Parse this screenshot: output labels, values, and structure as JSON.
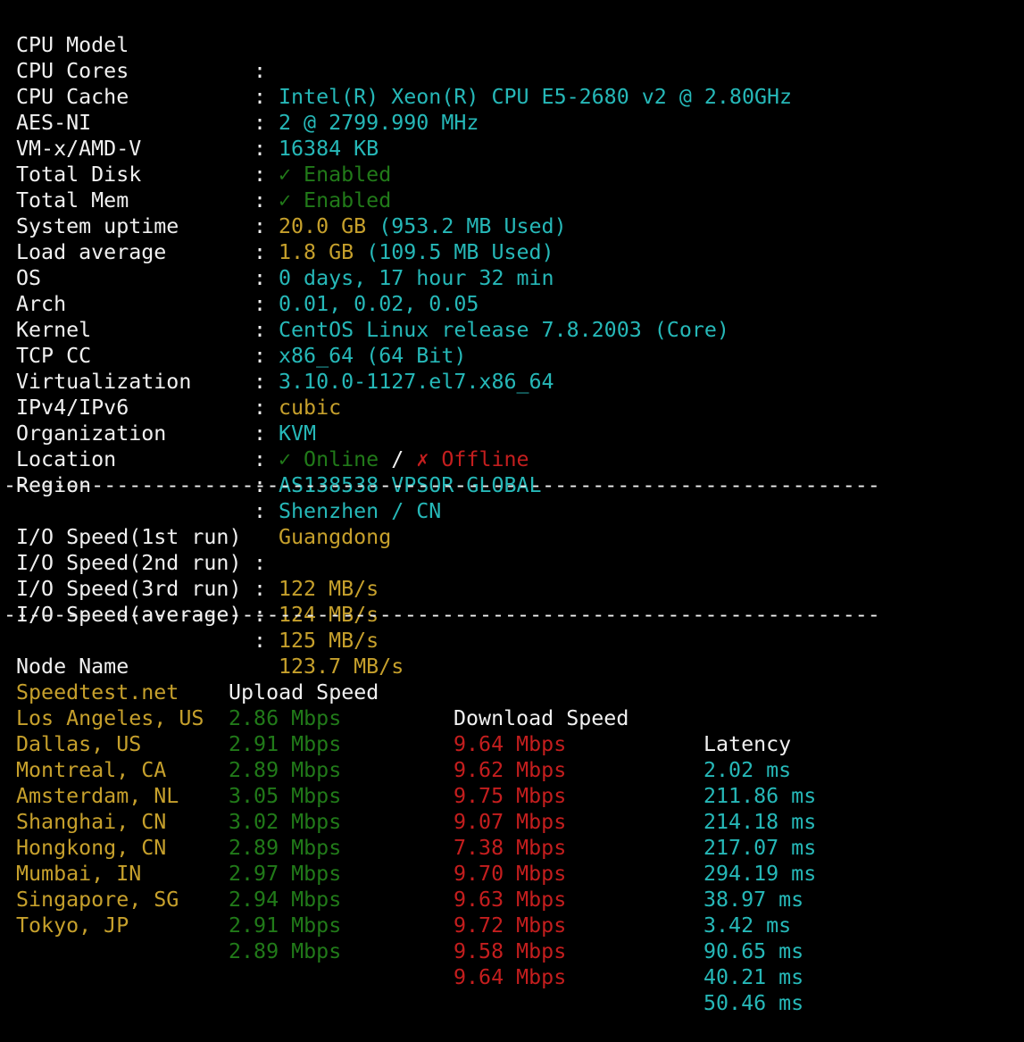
{
  "colors": {
    "background": "#000000",
    "label": "#f0f0f0",
    "cyan": "#26b8b8",
    "yellow": "#c6a02c",
    "green": "#217a19",
    "red": "#c41e1e"
  },
  "colon": ":",
  "system_info": {
    "cpu_model": {
      "label": "CPU Model",
      "value": "Intel(R) Xeon(R) CPU E5-2680 v2 @ 2.80GHz"
    },
    "cpu_cores": {
      "label": "CPU Cores",
      "value": "2 @ 2799.990 MHz"
    },
    "cpu_cache": {
      "label": "CPU Cache",
      "value": "16384 KB"
    },
    "aes_ni": {
      "label": "AES-NI",
      "value": "✓ Enabled"
    },
    "vmx": {
      "label": "VM-x/AMD-V",
      "value": "✓ Enabled"
    },
    "total_disk": {
      "label": "Total Disk",
      "value": "20.0 GB",
      "used": "(953.2 MB Used)"
    },
    "total_mem": {
      "label": "Total Mem",
      "value": "1.8 GB",
      "used": "(109.5 MB Used)"
    },
    "uptime": {
      "label": "System uptime",
      "value": "0 days, 17 hour 32 min"
    },
    "load": {
      "label": "Load average",
      "value": "0.01, 0.02, 0.05"
    },
    "os": {
      "label": "OS",
      "value": "CentOS Linux release 7.8.2003 (Core)"
    },
    "arch": {
      "label": "Arch",
      "value": "x86_64 (64 Bit)"
    },
    "kernel": {
      "label": "Kernel",
      "value": "3.10.0-1127.el7.x86_64"
    },
    "tcp_cc": {
      "label": "TCP CC",
      "value": "cubic"
    },
    "virt": {
      "label": "Virtualization",
      "value": "KVM"
    },
    "ip": {
      "label": "IPv4/IPv6",
      "v4": "✓ Online",
      "slash": "/",
      "v6": "✗ Offline"
    },
    "org": {
      "label": "Organization",
      "value": "AS138538 VPSOR-GLOBAL"
    },
    "location": {
      "label": "Location",
      "value": "Shenzhen / CN"
    },
    "region": {
      "label": "Region",
      "value": "Guangdong"
    }
  },
  "separator": "----------------------------------------------------------------------",
  "io": [
    {
      "label": "I/O Speed(1st run)",
      "value": "122 MB/s"
    },
    {
      "label": "I/O Speed(2nd run)",
      "value": "124 MB/s"
    },
    {
      "label": "I/O Speed(3rd run)",
      "value": "125 MB/s"
    },
    {
      "label": "I/O Speed(average)",
      "value": "123.7 MB/s"
    }
  ],
  "speedtest": {
    "headers": {
      "node": "Node Name",
      "upload": "Upload Speed",
      "download": "Download Speed",
      "latency": "Latency"
    },
    "rows": [
      {
        "node": "Speedtest.net",
        "upload": "2.86 Mbps",
        "download": "9.64 Mbps",
        "latency": "2.02 ms"
      },
      {
        "node": "Los Angeles, US",
        "upload": "2.91 Mbps",
        "download": "9.62 Mbps",
        "latency": "211.86 ms"
      },
      {
        "node": "Dallas, US",
        "upload": "2.89 Mbps",
        "download": "9.75 Mbps",
        "latency": "214.18 ms"
      },
      {
        "node": "Montreal, CA",
        "upload": "3.05 Mbps",
        "download": "9.07 Mbps",
        "latency": "217.07 ms"
      },
      {
        "node": "Amsterdam, NL",
        "upload": "3.02 Mbps",
        "download": "7.38 Mbps",
        "latency": "294.19 ms"
      },
      {
        "node": "Shanghai, CN",
        "upload": "2.89 Mbps",
        "download": "9.70 Mbps",
        "latency": "38.97 ms"
      },
      {
        "node": "Hongkong, CN",
        "upload": "2.97 Mbps",
        "download": "9.63 Mbps",
        "latency": "3.42 ms"
      },
      {
        "node": "Mumbai, IN",
        "upload": "2.94 Mbps",
        "download": "9.72 Mbps",
        "latency": "90.65 ms"
      },
      {
        "node": "Singapore, SG",
        "upload": "2.91 Mbps",
        "download": "9.58 Mbps",
        "latency": "40.21 ms"
      },
      {
        "node": "Tokyo, JP",
        "upload": "2.89 Mbps",
        "download": "9.64 Mbps",
        "latency": "50.46 ms"
      }
    ]
  }
}
